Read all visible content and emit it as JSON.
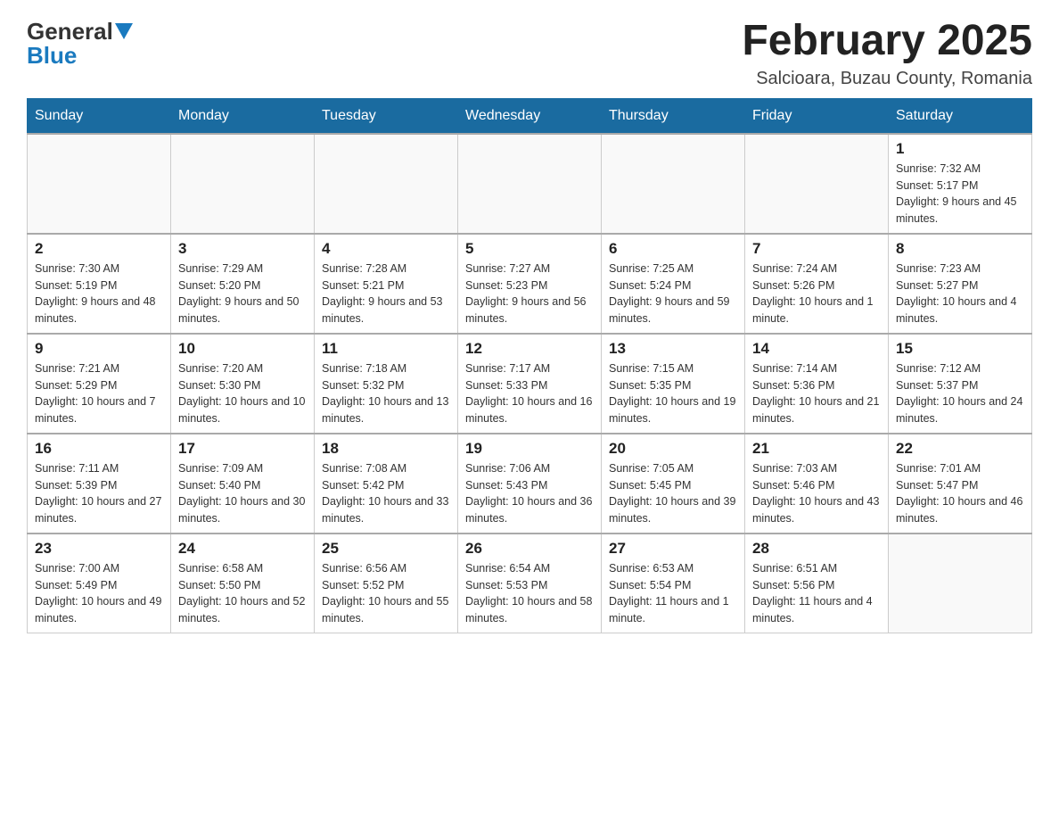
{
  "header": {
    "logo_general": "General",
    "logo_blue": "Blue",
    "month_title": "February 2025",
    "location": "Salcioara, Buzau County, Romania"
  },
  "days_of_week": [
    "Sunday",
    "Monday",
    "Tuesday",
    "Wednesday",
    "Thursday",
    "Friday",
    "Saturday"
  ],
  "weeks": [
    [
      {
        "day": "",
        "info": ""
      },
      {
        "day": "",
        "info": ""
      },
      {
        "day": "",
        "info": ""
      },
      {
        "day": "",
        "info": ""
      },
      {
        "day": "",
        "info": ""
      },
      {
        "day": "",
        "info": ""
      },
      {
        "day": "1",
        "info": "Sunrise: 7:32 AM\nSunset: 5:17 PM\nDaylight: 9 hours and 45 minutes."
      }
    ],
    [
      {
        "day": "2",
        "info": "Sunrise: 7:30 AM\nSunset: 5:19 PM\nDaylight: 9 hours and 48 minutes."
      },
      {
        "day": "3",
        "info": "Sunrise: 7:29 AM\nSunset: 5:20 PM\nDaylight: 9 hours and 50 minutes."
      },
      {
        "day": "4",
        "info": "Sunrise: 7:28 AM\nSunset: 5:21 PM\nDaylight: 9 hours and 53 minutes."
      },
      {
        "day": "5",
        "info": "Sunrise: 7:27 AM\nSunset: 5:23 PM\nDaylight: 9 hours and 56 minutes."
      },
      {
        "day": "6",
        "info": "Sunrise: 7:25 AM\nSunset: 5:24 PM\nDaylight: 9 hours and 59 minutes."
      },
      {
        "day": "7",
        "info": "Sunrise: 7:24 AM\nSunset: 5:26 PM\nDaylight: 10 hours and 1 minute."
      },
      {
        "day": "8",
        "info": "Sunrise: 7:23 AM\nSunset: 5:27 PM\nDaylight: 10 hours and 4 minutes."
      }
    ],
    [
      {
        "day": "9",
        "info": "Sunrise: 7:21 AM\nSunset: 5:29 PM\nDaylight: 10 hours and 7 minutes."
      },
      {
        "day": "10",
        "info": "Sunrise: 7:20 AM\nSunset: 5:30 PM\nDaylight: 10 hours and 10 minutes."
      },
      {
        "day": "11",
        "info": "Sunrise: 7:18 AM\nSunset: 5:32 PM\nDaylight: 10 hours and 13 minutes."
      },
      {
        "day": "12",
        "info": "Sunrise: 7:17 AM\nSunset: 5:33 PM\nDaylight: 10 hours and 16 minutes."
      },
      {
        "day": "13",
        "info": "Sunrise: 7:15 AM\nSunset: 5:35 PM\nDaylight: 10 hours and 19 minutes."
      },
      {
        "day": "14",
        "info": "Sunrise: 7:14 AM\nSunset: 5:36 PM\nDaylight: 10 hours and 21 minutes."
      },
      {
        "day": "15",
        "info": "Sunrise: 7:12 AM\nSunset: 5:37 PM\nDaylight: 10 hours and 24 minutes."
      }
    ],
    [
      {
        "day": "16",
        "info": "Sunrise: 7:11 AM\nSunset: 5:39 PM\nDaylight: 10 hours and 27 minutes."
      },
      {
        "day": "17",
        "info": "Sunrise: 7:09 AM\nSunset: 5:40 PM\nDaylight: 10 hours and 30 minutes."
      },
      {
        "day": "18",
        "info": "Sunrise: 7:08 AM\nSunset: 5:42 PM\nDaylight: 10 hours and 33 minutes."
      },
      {
        "day": "19",
        "info": "Sunrise: 7:06 AM\nSunset: 5:43 PM\nDaylight: 10 hours and 36 minutes."
      },
      {
        "day": "20",
        "info": "Sunrise: 7:05 AM\nSunset: 5:45 PM\nDaylight: 10 hours and 39 minutes."
      },
      {
        "day": "21",
        "info": "Sunrise: 7:03 AM\nSunset: 5:46 PM\nDaylight: 10 hours and 43 minutes."
      },
      {
        "day": "22",
        "info": "Sunrise: 7:01 AM\nSunset: 5:47 PM\nDaylight: 10 hours and 46 minutes."
      }
    ],
    [
      {
        "day": "23",
        "info": "Sunrise: 7:00 AM\nSunset: 5:49 PM\nDaylight: 10 hours and 49 minutes."
      },
      {
        "day": "24",
        "info": "Sunrise: 6:58 AM\nSunset: 5:50 PM\nDaylight: 10 hours and 52 minutes."
      },
      {
        "day": "25",
        "info": "Sunrise: 6:56 AM\nSunset: 5:52 PM\nDaylight: 10 hours and 55 minutes."
      },
      {
        "day": "26",
        "info": "Sunrise: 6:54 AM\nSunset: 5:53 PM\nDaylight: 10 hours and 58 minutes."
      },
      {
        "day": "27",
        "info": "Sunrise: 6:53 AM\nSunset: 5:54 PM\nDaylight: 11 hours and 1 minute."
      },
      {
        "day": "28",
        "info": "Sunrise: 6:51 AM\nSunset: 5:56 PM\nDaylight: 11 hours and 4 minutes."
      },
      {
        "day": "",
        "info": ""
      }
    ]
  ]
}
